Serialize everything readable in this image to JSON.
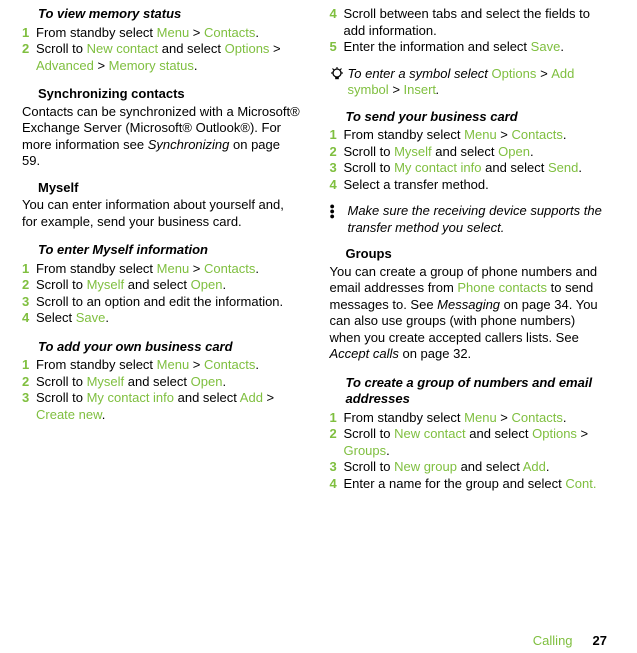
{
  "left": {
    "sec1": {
      "title": "To view memory status",
      "step1": {
        "n": "1",
        "pre": "From standby select ",
        "a": "Menu",
        "gt": " > ",
        "b": "Contacts",
        "end": "."
      },
      "step2": {
        "n": "2",
        "pre": "Scroll to ",
        "a": "New contact",
        "mid": " and select ",
        "b": "Options",
        "gt1": " > ",
        "c": "Advanced",
        "gt2": " > ",
        "d": "Memory status",
        "end": "."
      }
    },
    "sec2": {
      "title": "Synchronizing contacts",
      "para": "Contacts can be synchronized with a Microsoft® Exchange Server (Microsoft® Outlook®). For more information see ",
      "ital": "Synchronizing",
      "tail": " on page 59."
    },
    "sec3": {
      "title": "Myself",
      "para": "You can enter information about yourself and, for example, send your business card."
    },
    "sec4": {
      "title": "To enter Myself information",
      "step1": {
        "n": "1",
        "pre": "From standby select ",
        "a": "Menu",
        "gt": " > ",
        "b": "Contacts",
        "end": "."
      },
      "step2": {
        "n": "2",
        "pre": "Scroll to ",
        "a": "Myself",
        "mid": " and select ",
        "b": "Open",
        "end": "."
      },
      "step3": {
        "n": "3",
        "txt": "Scroll to an option and edit the information."
      },
      "step4": {
        "n": "4",
        "pre": "Select ",
        "a": "Save",
        "end": "."
      }
    },
    "sec5": {
      "title": "To add your own business card",
      "step1": {
        "n": "1",
        "pre": "From standby select ",
        "a": "Menu",
        "gt": " > ",
        "b": "Contacts",
        "end": "."
      },
      "step2": {
        "n": "2",
        "pre": "Scroll to ",
        "a": "Myself",
        "mid": " and select ",
        "b": "Open",
        "end": "."
      },
      "step3": {
        "n": "3",
        "pre": "Scroll to ",
        "a": "My contact info",
        "mid": " and select ",
        "b": "Add",
        "gt": " > ",
        "c": "Create new",
        "end": "."
      }
    }
  },
  "right": {
    "cont": {
      "step4": {
        "n": "4",
        "txt": "Scroll between tabs and select the fields to add information."
      },
      "step5": {
        "n": "5",
        "pre": "Enter the information and select ",
        "a": "Save",
        "end": "."
      }
    },
    "tip1": {
      "pre": "To enter a symbol select ",
      "a": "Options",
      "gt1": " > ",
      "b": "Add symbol",
      "gt2": " > ",
      "c": "Insert",
      "end": "."
    },
    "sec1": {
      "title": "To send your business card",
      "step1": {
        "n": "1",
        "pre": "From standby select ",
        "a": "Menu",
        "gt": " > ",
        "b": "Contacts",
        "end": "."
      },
      "step2": {
        "n": "2",
        "pre": "Scroll to ",
        "a": "Myself",
        "mid": " and select ",
        "b": "Open",
        "end": "."
      },
      "step3": {
        "n": "3",
        "pre": "Scroll to ",
        "a": "My contact info",
        "mid": " and select ",
        "b": "Send",
        "end": "."
      },
      "step4": {
        "n": "4",
        "txt": "Select a transfer method."
      }
    },
    "tip2": {
      "txt": "Make sure the receiving device supports the transfer method you select."
    },
    "sec2": {
      "title": "Groups",
      "para1": "You can create a group of phone numbers and email addresses from ",
      "link": "Phone contacts",
      "para2": " to send messages to. See ",
      "ital": "Messaging",
      "para3": " on page 34. You can also use groups (with phone numbers) when you create accepted callers lists. See ",
      "ital2": "Accept calls",
      "para4": " on page 32."
    },
    "sec3": {
      "title": "To create a group of numbers and email addresses",
      "step1": {
        "n": "1",
        "pre": "From standby select ",
        "a": "Menu",
        "gt": " > ",
        "b": "Contacts",
        "end": "."
      },
      "step2": {
        "n": "2",
        "pre": "Scroll to ",
        "a": "New contact",
        "mid": " and select ",
        "b": "Options",
        "gt": " > ",
        "c": "Groups",
        "end": "."
      },
      "step3": {
        "n": "3",
        "pre": "Scroll to ",
        "a": "New group",
        "mid": " and select ",
        "b": "Add",
        "end": "."
      },
      "step4": {
        "n": "4",
        "pre": "Enter a name for the group and select ",
        "a": "Cont.",
        "end": ""
      }
    }
  },
  "footer": {
    "section": "Calling",
    "page": "27"
  }
}
